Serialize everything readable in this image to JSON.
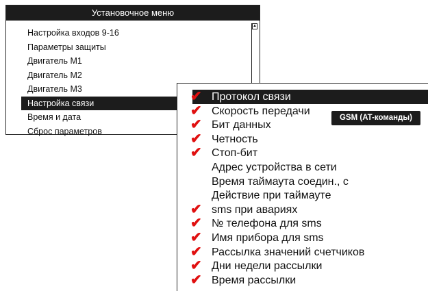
{
  "menu": {
    "title": "Установочное меню",
    "items": [
      {
        "label": "Настройка входов 9-16",
        "selected": false
      },
      {
        "label": "Параметры защиты",
        "selected": false
      },
      {
        "label": "Двигатель М1",
        "selected": false
      },
      {
        "label": "Двигатель М2",
        "selected": false
      },
      {
        "label": "Двигатель М3",
        "selected": false
      },
      {
        "label": "Настройка связи",
        "selected": true
      },
      {
        "label": "Время и дата",
        "selected": false
      },
      {
        "label": "Сброс параметров",
        "selected": false
      }
    ],
    "scroll_icon": "scroll-up-icon"
  },
  "submenu": {
    "items": [
      {
        "label": "Протокол связи",
        "checked": true,
        "selected": true
      },
      {
        "label": "Скорость передачи",
        "checked": true,
        "selected": false
      },
      {
        "label": "Бит данных",
        "checked": true,
        "selected": false
      },
      {
        "label": "Четность",
        "checked": true,
        "selected": false
      },
      {
        "label": "Стоп-бит",
        "checked": true,
        "selected": false
      },
      {
        "label": "Адрес устройства в сети",
        "checked": false,
        "selected": false
      },
      {
        "label": "Время таймаута соедин., с",
        "checked": false,
        "selected": false
      },
      {
        "label": "Действие при таймауте",
        "checked": false,
        "selected": false
      },
      {
        "label": "sms при авариях",
        "checked": true,
        "selected": false
      },
      {
        "label": "№ телефона для sms",
        "checked": true,
        "selected": false
      },
      {
        "label": "Имя прибора для sms",
        "checked": true,
        "selected": false
      },
      {
        "label": "Рассылка значений счетчиков",
        "checked": true,
        "selected": false
      },
      {
        "label": "Дни недели рассылки",
        "checked": true,
        "selected": false
      },
      {
        "label": "Время рассылки",
        "checked": true,
        "selected": false
      }
    ],
    "check_icon": "check-icon",
    "check_glyph": "✔",
    "check_color": "#e01010"
  },
  "badge": {
    "label": "GSM (AT-команды)"
  }
}
